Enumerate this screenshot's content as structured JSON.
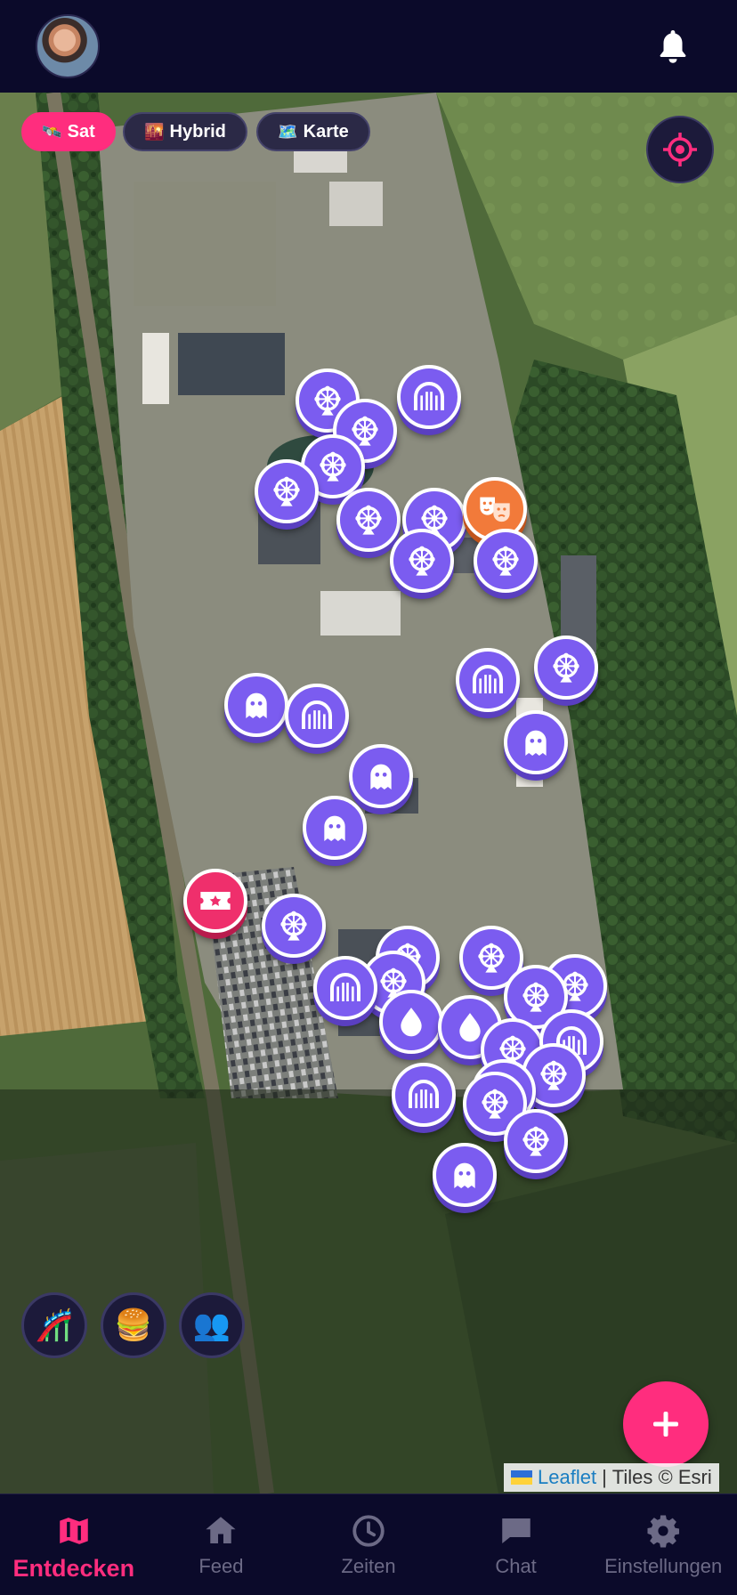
{
  "header": {
    "avatar_alt": "user-avatar",
    "bell_icon": "bell-icon"
  },
  "layers": [
    {
      "label": "Sat",
      "icon": "🛰️",
      "active": true
    },
    {
      "label": "Hybrid",
      "icon": "🌇",
      "active": false
    },
    {
      "label": "Karte",
      "icon": "🗺️",
      "active": false
    }
  ],
  "map": {
    "markers": [
      {
        "type": "ride"
      },
      {
        "type": "ride"
      },
      {
        "type": "coaster"
      },
      {
        "type": "ride"
      },
      {
        "type": "ride"
      },
      {
        "type": "ride"
      },
      {
        "type": "ride"
      },
      {
        "type": "show"
      },
      {
        "type": "ride"
      },
      {
        "type": "ride"
      },
      {
        "type": "coaster"
      },
      {
        "type": "ride"
      },
      {
        "type": "ghost"
      },
      {
        "type": "coaster"
      },
      {
        "type": "ghost"
      },
      {
        "type": "ghost"
      },
      {
        "type": "ghost"
      },
      {
        "type": "tickets"
      },
      {
        "type": "ride"
      },
      {
        "type": "ride"
      },
      {
        "type": "ride"
      },
      {
        "type": "coaster"
      },
      {
        "type": "ride"
      },
      {
        "type": "ride"
      },
      {
        "type": "ride"
      },
      {
        "type": "water"
      },
      {
        "type": "water"
      },
      {
        "type": "ride"
      },
      {
        "type": "coaster"
      },
      {
        "type": "ride"
      },
      {
        "type": "coaster"
      },
      {
        "type": "ride"
      },
      {
        "type": "ride"
      },
      {
        "type": "ride"
      },
      {
        "type": "ghost"
      }
    ],
    "attribution": {
      "leaflet": "Leaflet",
      "separator": "|",
      "tiles": "Tiles © Esri"
    }
  },
  "filters": [
    {
      "name": "attractions-filter",
      "icon": "🎢"
    },
    {
      "name": "food-filter",
      "icon": "🍔"
    },
    {
      "name": "friends-filter",
      "icon": "👥"
    }
  ],
  "fab": {
    "icon": "plus-icon"
  },
  "nav": [
    {
      "label": "Entdecken",
      "icon": "map-icon",
      "active": true
    },
    {
      "label": "Feed",
      "icon": "home-icon",
      "active": false
    },
    {
      "label": "Zeiten",
      "icon": "clock-icon",
      "active": false
    },
    {
      "label": "Chat",
      "icon": "chat-icon",
      "active": false
    },
    {
      "label": "Einstellungen",
      "icon": "gear-icon",
      "active": false
    }
  ],
  "colors": {
    "accent": "#ff2d7e",
    "marker": "#7b5cf0",
    "background": "#0b0a2a"
  }
}
